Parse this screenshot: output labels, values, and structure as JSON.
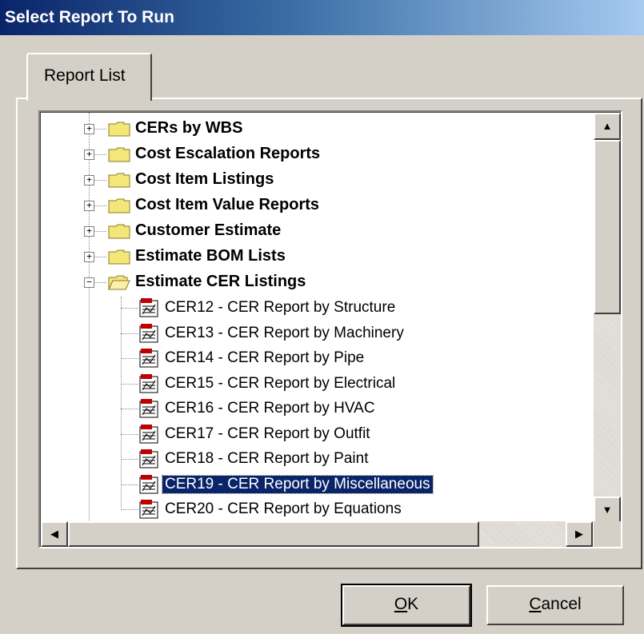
{
  "window": {
    "title": "Select Report To Run"
  },
  "tabs": [
    {
      "label": "Report List"
    }
  ],
  "tree": {
    "folders": [
      {
        "label": "CERs by WBS",
        "expanded": false
      },
      {
        "label": "Cost Escalation Reports",
        "expanded": false
      },
      {
        "label": "Cost Item Listings",
        "expanded": false
      },
      {
        "label": "Cost Item Value Reports",
        "expanded": false
      },
      {
        "label": "Customer Estimate",
        "expanded": false
      },
      {
        "label": "Estimate BOM Lists",
        "expanded": false
      },
      {
        "label": "Estimate CER Listings",
        "expanded": true
      }
    ],
    "reports": [
      {
        "label": "CER12 - CER Report by Structure"
      },
      {
        "label": "CER13 - CER Report by Machinery"
      },
      {
        "label": "CER14 - CER Report by Pipe"
      },
      {
        "label": "CER15 - CER Report by Electrical"
      },
      {
        "label": "CER16 - CER Report by HVAC"
      },
      {
        "label": "CER17 - CER Report by Outfit"
      },
      {
        "label": "CER18 - CER Report by Paint"
      },
      {
        "label": "CER19 - CER Report by Miscellaneous",
        "selected": true
      },
      {
        "label": "CER20 - CER Report by Equations"
      }
    ],
    "expander_collapsed": "+",
    "expander_expanded": "−"
  },
  "scrollbar": {
    "up_arrow": "▲",
    "down_arrow": "▼",
    "left_arrow": "◀",
    "right_arrow": "▶"
  },
  "buttons": {
    "ok": {
      "mnemonic": "O",
      "rest": "K"
    },
    "cancel": {
      "mnemonic": "C",
      "rest": "ancel"
    }
  },
  "colors": {
    "selection": "#0a246a",
    "folder": "#f5e67a",
    "face": "#d4d0c8"
  }
}
